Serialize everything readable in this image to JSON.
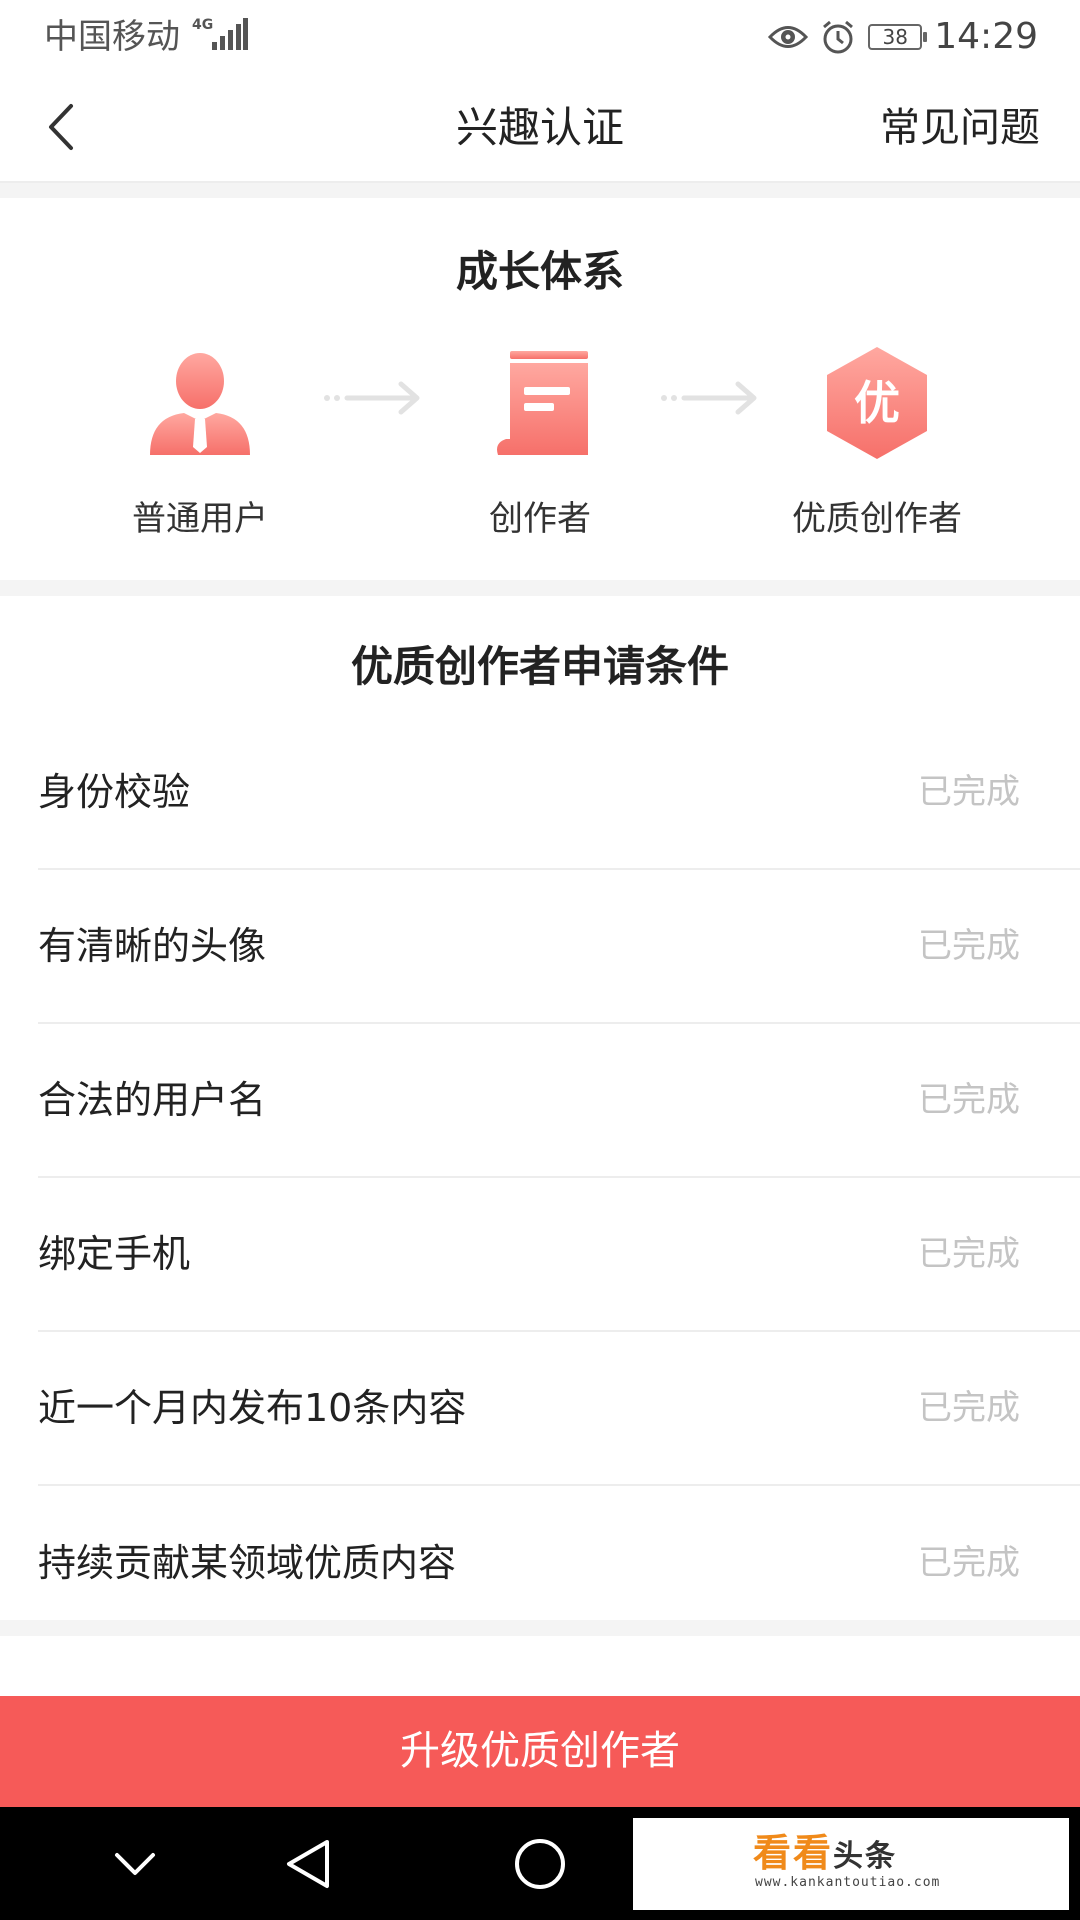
{
  "status_bar": {
    "carrier": "中国移动",
    "network": "4G",
    "battery": "38",
    "time": "14:29"
  },
  "nav": {
    "back_icon": "chevron-left-icon",
    "title": "兴趣认证",
    "faq": "常见问题"
  },
  "growth": {
    "title": "成长体系",
    "steps": [
      {
        "label": "普通用户",
        "icon": "user-icon"
      },
      {
        "label": "创作者",
        "icon": "document-icon"
      },
      {
        "label": "优质创作者",
        "icon": "premium-hexagon-icon",
        "badge_char": "优"
      }
    ]
  },
  "conditions": {
    "title": "优质创作者申请条件",
    "items": [
      {
        "label": "身份校验",
        "status": "已完成"
      },
      {
        "label": "有清晰的头像",
        "status": "已完成"
      },
      {
        "label": "合法的用户名",
        "status": "已完成"
      },
      {
        "label": "绑定手机",
        "status": "已完成"
      },
      {
        "label": "近一个月内发布10条内容",
        "status": "已完成"
      },
      {
        "label": "持续贡献某领域优质内容",
        "status": "已完成"
      }
    ]
  },
  "upgrade_button": "升级优质创作者",
  "watermark": {
    "main": "看看",
    "secondary": "头条",
    "url": "www.kankantoutiao.com"
  },
  "colors": {
    "accent": "#f65a58",
    "icon_gradient_top": "#ffa8a0",
    "icon_gradient_bottom": "#f6706a",
    "done_text": "#c4c4c4"
  }
}
